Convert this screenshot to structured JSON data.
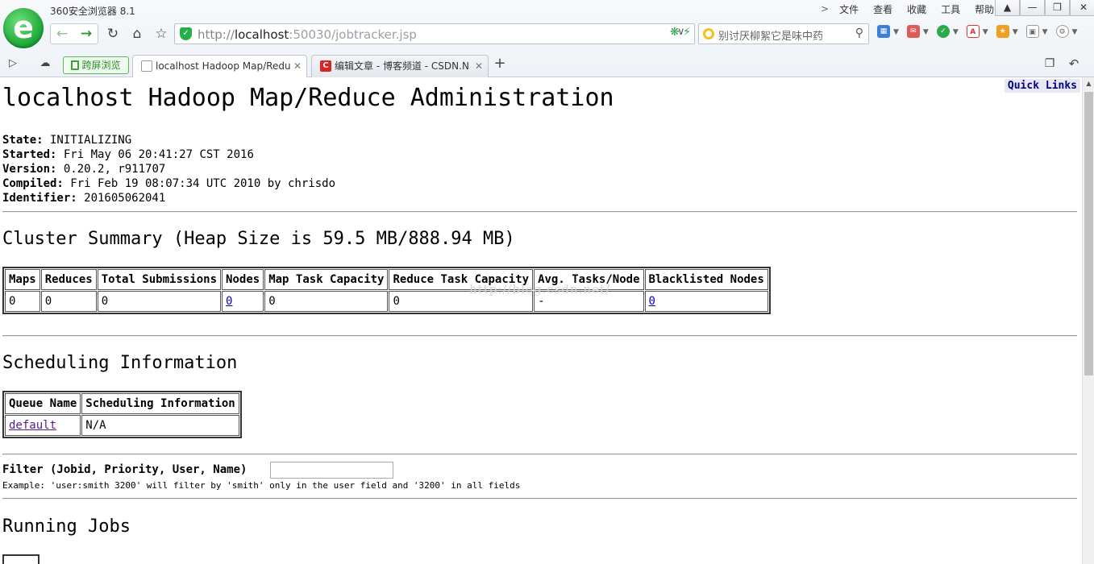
{
  "browser": {
    "title": "360安全浏览器 8.1",
    "menu": [
      "文件",
      "查看",
      "收藏",
      "工具",
      "帮助"
    ],
    "url_prefix": "http://",
    "url_host": "localhost",
    "url_rest": ":50030/jobtracker.jsp",
    "search_placeholder": "别讨厌柳絮它是味中药",
    "split_tab_label": "跨屏浏览",
    "tabs": [
      {
        "label": "localhost Hadoop Map/Redu"
      },
      {
        "label": "编辑文章 - 博客频道 - CSDN.N"
      }
    ]
  },
  "page": {
    "quick_links": "Quick Links",
    "title": "localhost Hadoop Map/Reduce Administration",
    "info": [
      {
        "key": "State:",
        "value": " INITIALIZING"
      },
      {
        "key": "Started:",
        "value": " Fri May 06 20:41:27 CST 2016"
      },
      {
        "key": "Version:",
        "value": " 0.20.2, r911707"
      },
      {
        "key": "Compiled:",
        "value": " Fri Feb 19 08:07:34 UTC 2010 by chrisdo"
      },
      {
        "key": "Identifier:",
        "value": " 201605062041"
      }
    ],
    "cluster_summary_title": "Cluster Summary (Heap Size is 59.5 MB/888.94 MB)",
    "cluster_headers": [
      "Maps",
      "Reduces",
      "Total Submissions",
      "Nodes",
      "Map Task Capacity",
      "Reduce Task Capacity",
      "Avg. Tasks/Node",
      "Blacklisted Nodes"
    ],
    "cluster_values": [
      "0",
      "0",
      "0",
      "0",
      "0",
      "0",
      "-",
      "0"
    ],
    "scheduling_title": "Scheduling Information",
    "scheduling_headers": [
      "Queue Name",
      "Scheduling Information"
    ],
    "scheduling_values": [
      "default",
      "N/A"
    ],
    "filter_label": "Filter (Jobid, Priority, User, Name)",
    "filter_example": "Example: 'user:smith 3200' will filter by 'smith' only in the user field and '3200' in all fields",
    "running_jobs_title": "Running Jobs",
    "watermark": "http://blog.csdn.net/"
  }
}
